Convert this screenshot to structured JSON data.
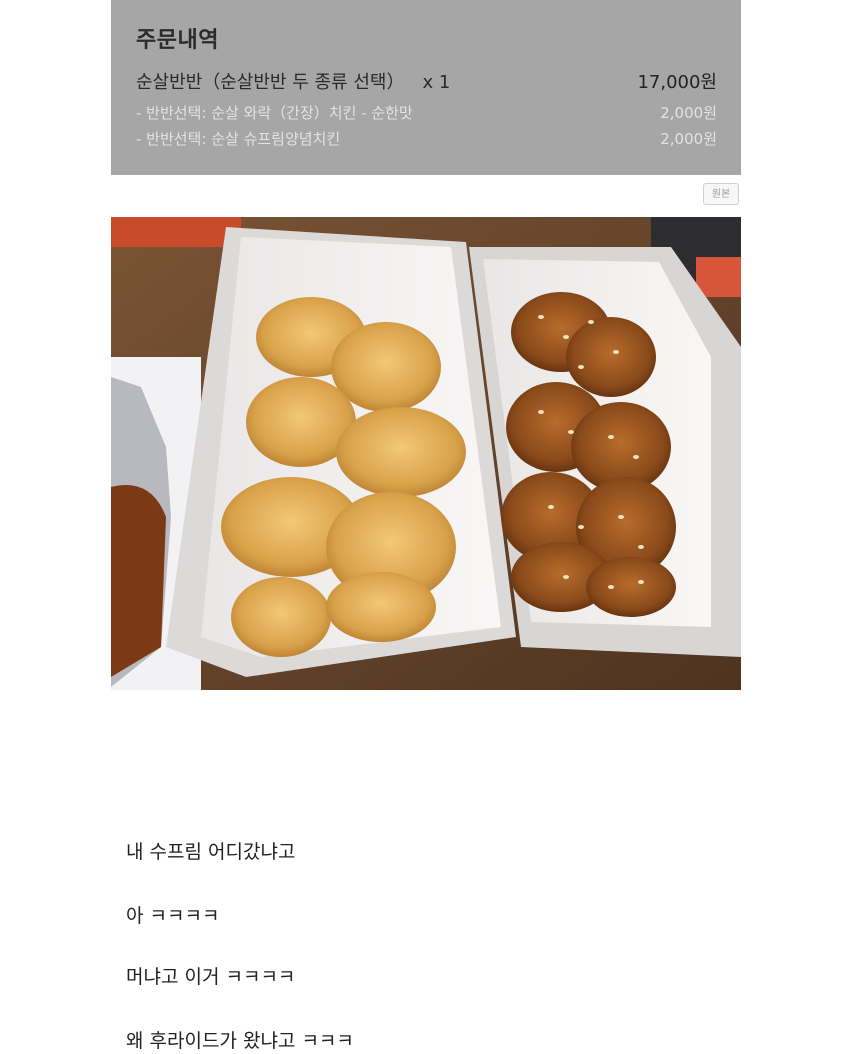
{
  "order": {
    "title": "주문내역",
    "item_name": "순살반반（순살반반 두 종류 선택）",
    "item_qty": "x 1",
    "item_price": "17,000원",
    "options": [
      {
        "label": "- 반반선택: 순살 와락（간장）치킨 - 순한맛",
        "price": "2,000원"
      },
      {
        "label": "- 반반선택: 순살 슈프림양념치킨",
        "price": "2,000원"
      }
    ]
  },
  "original_button": {
    "label": "원본"
  },
  "photo": {
    "icon": "fried-chicken-photo"
  },
  "comments": [
    "내 수프림 어디갔냐고",
    "아 ㅋㅋㅋㅋ",
    "머냐고 이거 ㅋㅋㅋㅋ",
    "왜 후라이드가 왔냐고 ㅋㅋㅋ"
  ]
}
